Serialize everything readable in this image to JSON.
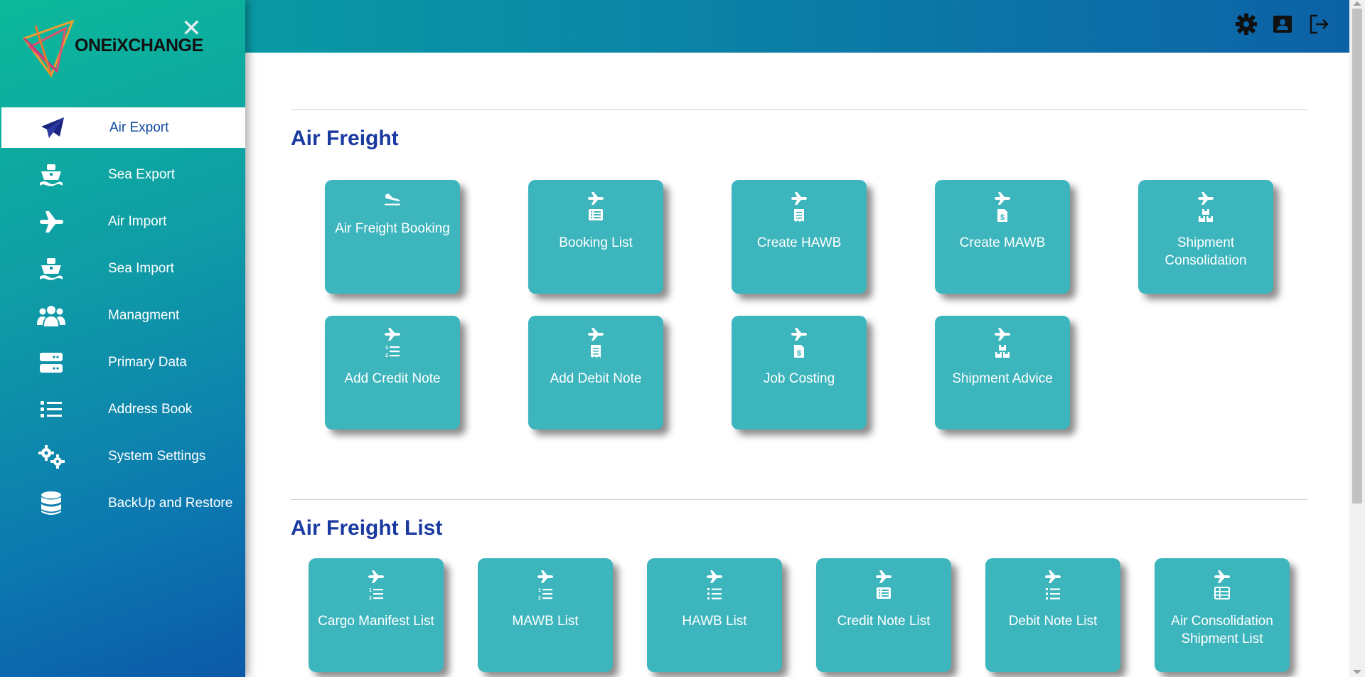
{
  "brand": {
    "name": "ONEiXCHANGE"
  },
  "sidebar": {
    "items": [
      {
        "label": "Air Export",
        "icon": "paper-plane-icon",
        "active": true
      },
      {
        "label": "Sea Export",
        "icon": "ship-icon"
      },
      {
        "label": "Air Import",
        "icon": "plane-icon"
      },
      {
        "label": "Sea Import",
        "icon": "ship-icon"
      },
      {
        "label": "Managment",
        "icon": "users-icon"
      },
      {
        "label": "Primary Data",
        "icon": "server-icon"
      },
      {
        "label": "Address Book",
        "icon": "list-icon"
      },
      {
        "label": "System Settings",
        "icon": "gears-icon"
      },
      {
        "label": "BackUp and Restore",
        "icon": "database-icon"
      }
    ]
  },
  "topbar": {
    "icons": [
      "settings-icon",
      "profile-card-icon",
      "logout-icon"
    ]
  },
  "sections": {
    "air_freight": {
      "title": "Air Freight",
      "tiles": [
        {
          "label": "Air Freight Booking",
          "icons": [
            "plane-landing-icon"
          ]
        },
        {
          "label": "Booking List",
          "icons": [
            "plane-icon",
            "list-card-icon"
          ]
        },
        {
          "label": "Create HAWB",
          "icons": [
            "plane-icon",
            "receipt-icon"
          ]
        },
        {
          "label": "Create MAWB",
          "icons": [
            "plane-icon",
            "invoice-dollar-icon"
          ]
        },
        {
          "label": "Shipment Consolidation",
          "icons": [
            "plane-icon",
            "boxes-icon"
          ]
        },
        {
          "label": "Add Credit Note",
          "icons": [
            "plane-icon",
            "numbered-list-icon"
          ]
        },
        {
          "label": "Add Debit Note",
          "icons": [
            "plane-icon",
            "receipt-icon"
          ]
        },
        {
          "label": "Job Costing",
          "icons": [
            "plane-icon",
            "invoice-dollar-icon"
          ]
        },
        {
          "label": "Shipment Advice",
          "icons": [
            "plane-icon",
            "boxes-icon"
          ]
        }
      ]
    },
    "air_freight_list": {
      "title": "Air Freight List",
      "tiles": [
        {
          "label": "Cargo Manifest List",
          "icons": [
            "plane-icon",
            "numbered-list-icon"
          ]
        },
        {
          "label": "MAWB List",
          "icons": [
            "plane-icon",
            "numbered-list-icon"
          ]
        },
        {
          "label": "HAWB List",
          "icons": [
            "plane-icon",
            "list-icon"
          ]
        },
        {
          "label": "Credit Note List",
          "icons": [
            "plane-icon",
            "list-card-icon"
          ]
        },
        {
          "label": "Debit Note List",
          "icons": [
            "plane-icon",
            "list-icon"
          ]
        },
        {
          "label": "Air Consolidation Shipment List",
          "icons": [
            "plane-icon",
            "table-list-icon"
          ]
        }
      ]
    }
  },
  "colors": {
    "tile": "#3db5bd",
    "section_title": "#1a3aa0",
    "active_item_text": "#0d47a1"
  }
}
